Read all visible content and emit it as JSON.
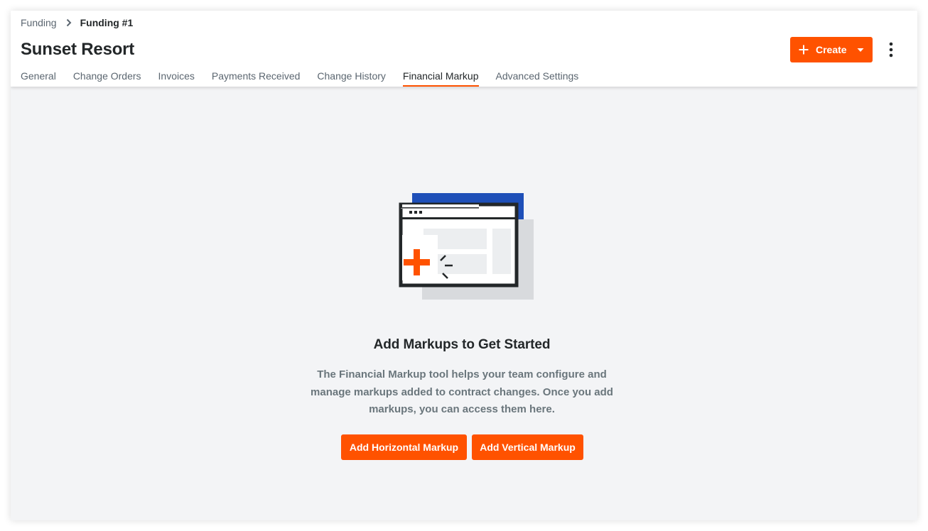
{
  "breadcrumb": {
    "parent": "Funding",
    "current": "Funding #1",
    "separator_icon": "chevron-right-icon"
  },
  "page": {
    "title": "Sunset Resort"
  },
  "header_actions": {
    "create_label": "Create",
    "create_icon": "plus-icon",
    "create_menu_icon": "caret-down-icon",
    "more_icon": "more-vertical-icon"
  },
  "tabs": [
    {
      "label": "General",
      "active": false
    },
    {
      "label": "Change Orders",
      "active": false
    },
    {
      "label": "Invoices",
      "active": false
    },
    {
      "label": "Payments Received",
      "active": false
    },
    {
      "label": "Change History",
      "active": false
    },
    {
      "label": "Financial Markup",
      "active": true
    },
    {
      "label": "Advanced Settings",
      "active": false
    }
  ],
  "empty_state": {
    "illustration": "add-markup-window-illustration",
    "title": "Add Markups to Get Started",
    "description": "The Financial Markup tool helps your team configure and manage markups added to contract changes. Once you add markups, you can access them here.",
    "buttons": {
      "horizontal": "Add Horizontal Markup",
      "vertical": "Add Vertical Markup"
    }
  },
  "colors": {
    "accent": "#ff5200",
    "illustration_blue": "#1e4fb8",
    "text_primary": "#232729",
    "text_secondary": "#5b6670",
    "background": "#f3f4f6"
  }
}
